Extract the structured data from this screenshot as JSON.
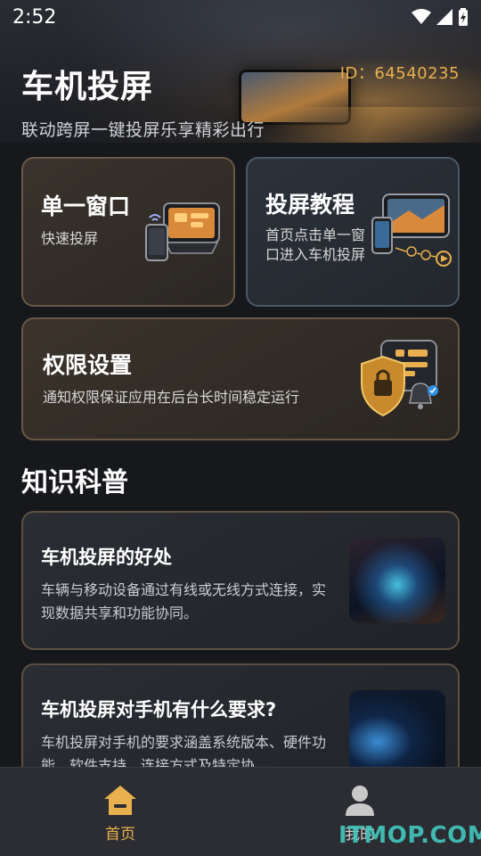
{
  "status_bar": {
    "time": "2:52"
  },
  "header": {
    "title": "车机投屏",
    "id_text": "ID：64540235",
    "subtitle": "联动跨屏一键投屏乐享精彩出行"
  },
  "cards": {
    "single": {
      "title": "单一窗口",
      "desc": "快速投屏"
    },
    "tutorial": {
      "title": "投屏教程",
      "desc_line1": "首页点击单一窗",
      "desc_line2": "口进入车机投屏"
    },
    "permission": {
      "title": "权限设置",
      "desc": "通知权限保证应用在后台长时间稳定运行"
    }
  },
  "knowledge": {
    "title": "知识科普",
    "articles": [
      {
        "title": "车机投屏的好处",
        "desc": "车辆与移动设备通过有线或无线方式连接，实现数据共享和功能协同。"
      },
      {
        "title": "车机投屏对手机有什么要求?",
        "desc": "车机投屏对手机的要求涵盖系统版本、硬件功能、软件支持、连接方式及特定协"
      }
    ]
  },
  "tabbar": {
    "home_label": "首页",
    "me_label": "我的"
  },
  "watermark": "ITMOP.COM",
  "colors": {
    "accent": "#e8b04f",
    "background": "#16181c",
    "card_border_warm": "#6a5846",
    "card_border_cool": "#4c5868"
  }
}
